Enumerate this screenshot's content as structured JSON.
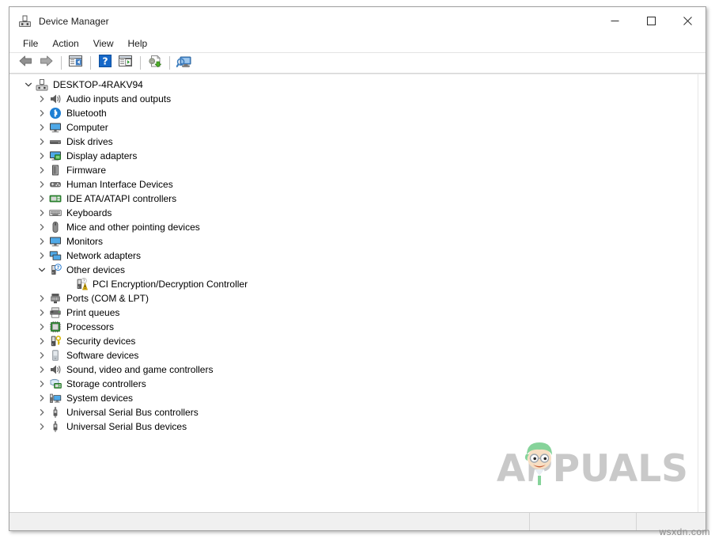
{
  "window": {
    "title": "Device Manager",
    "icon": "device-manager-icon",
    "controls": {
      "minimize": "Minimize",
      "maximize": "Maximize",
      "close": "Close"
    }
  },
  "menubar": {
    "items": [
      {
        "label": "File"
      },
      {
        "label": "Action"
      },
      {
        "label": "View"
      },
      {
        "label": "Help"
      }
    ]
  },
  "toolbar": {
    "buttons": [
      {
        "name": "back-icon",
        "title": "Back"
      },
      {
        "name": "forward-icon",
        "title": "Forward"
      },
      {
        "name": "separator"
      },
      {
        "name": "show-hide-console-tree-icon",
        "title": "Show/Hide Console Tree"
      },
      {
        "name": "separator"
      },
      {
        "name": "help-icon",
        "title": "Help"
      },
      {
        "name": "properties-icon",
        "title": "Properties"
      },
      {
        "name": "separator"
      },
      {
        "name": "update-driver-icon",
        "title": "Update Driver Software"
      },
      {
        "name": "separator"
      },
      {
        "name": "scan-hardware-changes-icon",
        "title": "Scan for hardware changes"
      }
    ]
  },
  "tree": {
    "root": {
      "label": "DESKTOP-4RAKV94",
      "icon": "computer-root-icon",
      "expanded": true,
      "level": 0
    },
    "nodes": [
      {
        "label": "Audio inputs and outputs",
        "icon": "speaker-icon",
        "expanded": false,
        "level": 1
      },
      {
        "label": "Bluetooth",
        "icon": "bluetooth-icon",
        "expanded": false,
        "level": 1
      },
      {
        "label": "Computer",
        "icon": "monitor-icon",
        "expanded": false,
        "level": 1
      },
      {
        "label": "Disk drives",
        "icon": "disk-drive-icon",
        "expanded": false,
        "level": 1
      },
      {
        "label": "Display adapters",
        "icon": "display-adapter-icon",
        "expanded": false,
        "level": 1
      },
      {
        "label": "Firmware",
        "icon": "firmware-chip-icon",
        "expanded": false,
        "level": 1
      },
      {
        "label": "Human Interface Devices",
        "icon": "gamepad-icon",
        "expanded": false,
        "level": 1
      },
      {
        "label": "IDE ATA/ATAPI controllers",
        "icon": "ide-controller-icon",
        "expanded": false,
        "level": 1
      },
      {
        "label": "Keyboards",
        "icon": "keyboard-icon",
        "expanded": false,
        "level": 1
      },
      {
        "label": "Mice and other pointing devices",
        "icon": "mouse-icon",
        "expanded": false,
        "level": 1
      },
      {
        "label": "Monitors",
        "icon": "monitor-icon",
        "expanded": false,
        "level": 1
      },
      {
        "label": "Network adapters",
        "icon": "network-adapter-icon",
        "expanded": false,
        "level": 1
      },
      {
        "label": "Other devices",
        "icon": "unknown-device-icon",
        "expanded": true,
        "level": 1
      },
      {
        "label": "PCI Encryption/Decryption Controller",
        "icon": "unknown-device-warning-icon",
        "expanded": null,
        "level": 2,
        "warning": true
      },
      {
        "label": "Ports (COM & LPT)",
        "icon": "port-icon",
        "expanded": false,
        "level": 1
      },
      {
        "label": "Print queues",
        "icon": "printer-icon",
        "expanded": false,
        "level": 1
      },
      {
        "label": "Processors",
        "icon": "processor-icon",
        "expanded": false,
        "level": 1
      },
      {
        "label": "Security devices",
        "icon": "security-device-icon",
        "expanded": false,
        "level": 1
      },
      {
        "label": "Software devices",
        "icon": "software-device-icon",
        "expanded": false,
        "level": 1
      },
      {
        "label": "Sound, video and game controllers",
        "icon": "speaker-icon",
        "expanded": false,
        "level": 1
      },
      {
        "label": "Storage controllers",
        "icon": "storage-controller-icon",
        "expanded": false,
        "level": 1
      },
      {
        "label": "System devices",
        "icon": "system-device-icon",
        "expanded": false,
        "level": 1
      },
      {
        "label": "Universal Serial Bus controllers",
        "icon": "usb-icon",
        "expanded": false,
        "level": 1
      },
      {
        "label": "Universal Serial Bus devices",
        "icon": "usb-icon",
        "expanded": false,
        "level": 1
      }
    ]
  },
  "statusbar": {
    "message": "",
    "segment_b": "",
    "segment_c": ""
  },
  "watermarks": {
    "brand": "APPUALS",
    "site": "wsxdn.com"
  },
  "colors": {
    "accent_blue": "#2f7fd1",
    "warning_yellow": "#f5c518",
    "title_text": "#1a1a1a",
    "watermark_gray": "#c9c9c9",
    "statusbar_bg": "#f0f0f0",
    "device_green": "#4a9f3f"
  }
}
